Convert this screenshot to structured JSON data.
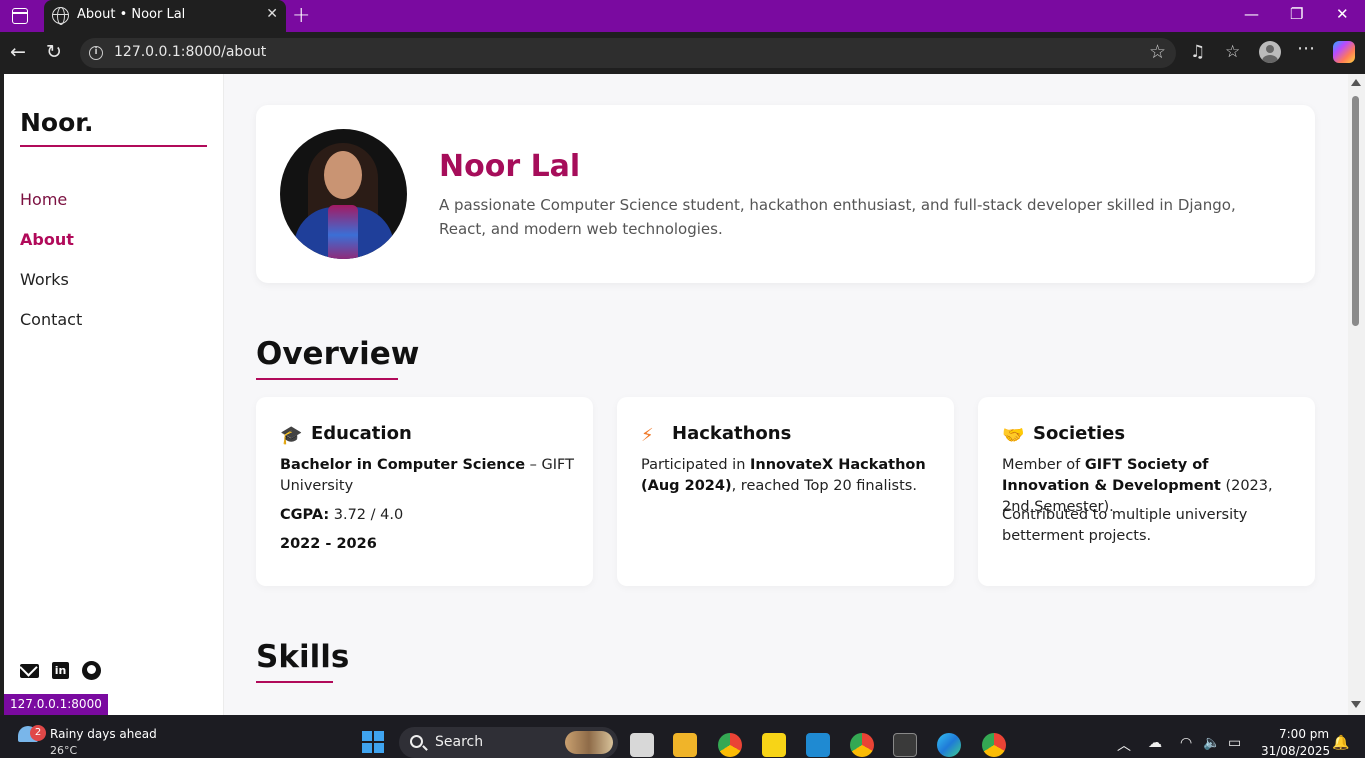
{
  "browser": {
    "tab_title": "About • Noor Lal",
    "url": "127.0.0.1:8000/about",
    "status_url": "127.0.0.1:8000"
  },
  "sidebar": {
    "logo": "Noor.",
    "nav": [
      {
        "label": "Home"
      },
      {
        "label": "About"
      },
      {
        "label": "Works"
      },
      {
        "label": "Contact"
      }
    ],
    "social_icons": [
      "mail-icon",
      "linkedin-icon",
      "github-icon"
    ]
  },
  "hero": {
    "name": "Noor Lal",
    "description": "A passionate Computer Science student, hackathon enthusiast, and full-stack developer skilled in Django, React, and modern web technologies."
  },
  "overview": {
    "title": "Overview",
    "cards": [
      {
        "icon": "🎓",
        "title": "Education",
        "degree": "Bachelor in Computer Science",
        "university": " – GIFT University",
        "cgpa_label": "CGPA:",
        "cgpa_value": " 3.72 / 4.0",
        "years": "2022 - 2026"
      },
      {
        "icon": "⚡",
        "title": "Hackathons",
        "prefix": "Participated in ",
        "event": "InnovateX Hackathon (Aug 2024)",
        "suffix": ", reached Top 20 finalists."
      },
      {
        "icon": "🤝",
        "title": "Societies",
        "prefix": "Member of ",
        "society": "GIFT Society of Innovation & Development",
        "suffix": " (2023, 2nd Semester).",
        "extra": "Contributed to multiple university betterment projects."
      }
    ]
  },
  "skills": {
    "title": "Skills"
  },
  "taskbar": {
    "weather_badge": "2",
    "weather_text": "Rainy days ahead",
    "temperature": "26°C",
    "search_label": "Search",
    "time": "7:00 pm",
    "date": "31/08/2025"
  },
  "colors": {
    "accent": "#b10a5a",
    "titlebar": "#7a0aa0"
  }
}
